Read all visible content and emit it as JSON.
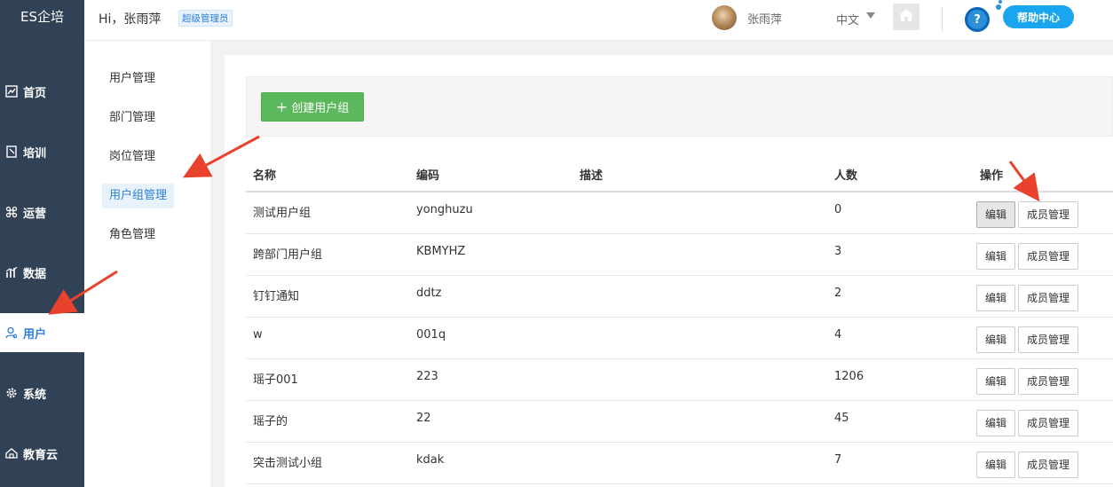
{
  "app": {
    "logo": "ES企培"
  },
  "header": {
    "greeting": "Hi，张雨萍",
    "role_badge": "超级管理员",
    "user_name": "张雨萍",
    "language": "中文",
    "help_label": "帮助中心",
    "help_icon_text": "?"
  },
  "leftnav": {
    "items": [
      {
        "label": "首页",
        "icon": "chart-line-icon"
      },
      {
        "label": "培训",
        "icon": "book-icon"
      },
      {
        "label": "运营",
        "icon": "command-icon"
      },
      {
        "label": "数据",
        "icon": "bar-chart-icon"
      },
      {
        "label": "用户",
        "icon": "user-icon",
        "active": true
      },
      {
        "label": "系统",
        "icon": "gear-icon"
      },
      {
        "label": "教育云",
        "icon": "cloud-icon"
      }
    ]
  },
  "subnav": {
    "items": [
      {
        "label": "用户管理"
      },
      {
        "label": "部门管理"
      },
      {
        "label": "岗位管理"
      },
      {
        "label": "用户组管理",
        "active": true
      },
      {
        "label": "角色管理"
      }
    ]
  },
  "toolbar": {
    "create_label": "创建用户组",
    "create_icon": "+"
  },
  "table": {
    "columns": [
      "名称",
      "编码",
      "描述",
      "人数",
      "操作"
    ],
    "rows": [
      {
        "name": "测试用户组",
        "code": "yonghuzu",
        "desc": "",
        "count": "0"
      },
      {
        "name": "跨部门用户组",
        "code": "KBMYHZ",
        "desc": "",
        "count": "3"
      },
      {
        "name": "钉钉通知",
        "code": "ddtz",
        "desc": "",
        "count": "2"
      },
      {
        "name": "w",
        "code": "001q",
        "desc": "",
        "count": "4"
      },
      {
        "name": "瑶子001",
        "code": "223",
        "desc": "",
        "count": "1206"
      },
      {
        "name": "瑶子的",
        "code": "22",
        "desc": "",
        "count": "45"
      },
      {
        "name": "突击测试小组",
        "code": "kdak",
        "desc": "",
        "count": "7"
      }
    ],
    "edit_label": "编辑",
    "members_label": "成员管理"
  },
  "colors": {
    "nav_bg": "#324256",
    "accent": "#2f7fd8",
    "create_btn": "#5cb85c",
    "arrow": "#e8412c"
  }
}
